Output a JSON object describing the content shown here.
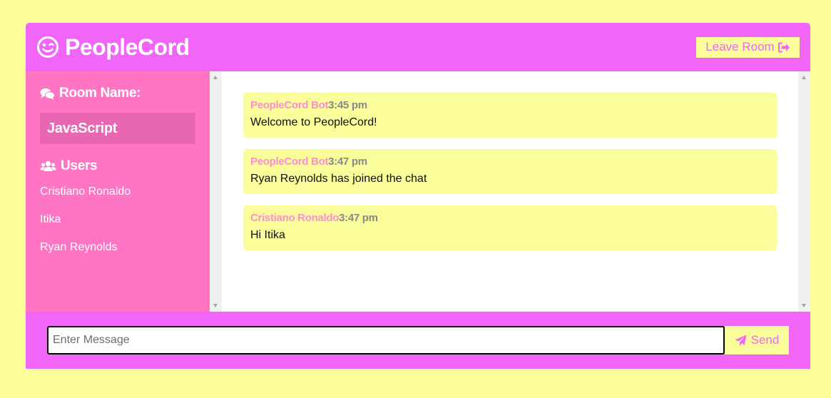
{
  "colors": {
    "background": "#fbfd9b",
    "accent": "#f165f9",
    "sidebar": "#ff75c4",
    "room_highlight": "#e866b2",
    "sender_name": "#ff8fcf"
  },
  "header": {
    "brand_icon": "wink-face-icon",
    "brand_name": "PeopleCord",
    "leave_label": "Leave Room",
    "leave_icon": "sign-out-icon"
  },
  "sidebar": {
    "room_heading_icon": "comments-icon",
    "room_heading": "Room Name:",
    "room_name": "JavaScript",
    "users_heading_icon": "users-icon",
    "users_heading": "Users",
    "users": [
      "Cristiano Ronaldo",
      "Itika",
      "Ryan Reynolds"
    ]
  },
  "messages": [
    {
      "sender": "PeopleCord Bot",
      "time": "3:45 pm",
      "text": "Welcome to PeopleCord!"
    },
    {
      "sender": "PeopleCord Bot",
      "time": "3:47 pm",
      "text": "Ryan Reynolds has joined the chat"
    },
    {
      "sender": "Cristiano Ronaldo",
      "time": "3:47 pm",
      "text": "Hi Itika"
    }
  ],
  "composer": {
    "placeholder": "Enter Message",
    "value": "",
    "send_icon": "paper-plane-icon",
    "send_label": "Send"
  }
}
